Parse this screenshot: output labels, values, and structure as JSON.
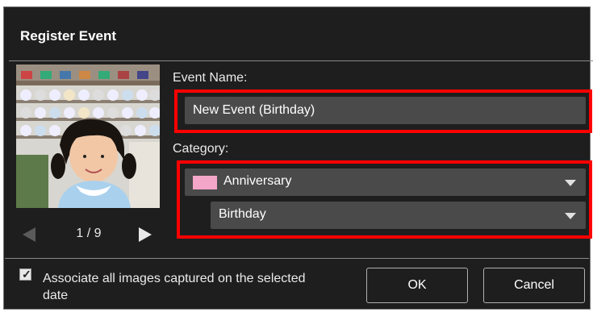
{
  "dialog": {
    "title": "Register Event"
  },
  "preview": {
    "page_indicator": "1 / 9"
  },
  "form": {
    "event_name_label": "Event Name:",
    "event_name_value": "New Event (Birthday)",
    "category_label": "Category:",
    "category_value": "Anniversary",
    "category_color": "#f4a6c8",
    "subcategory_value": "Birthday"
  },
  "footer": {
    "associate_label": "Associate all images captured on the selected date",
    "associate_checked": true,
    "ok_label": "OK",
    "cancel_label": "Cancel"
  },
  "colors": {
    "highlight": "#ff0000",
    "dialog_bg": "#1e1e1e",
    "field_bg": "#4a4a4a"
  }
}
